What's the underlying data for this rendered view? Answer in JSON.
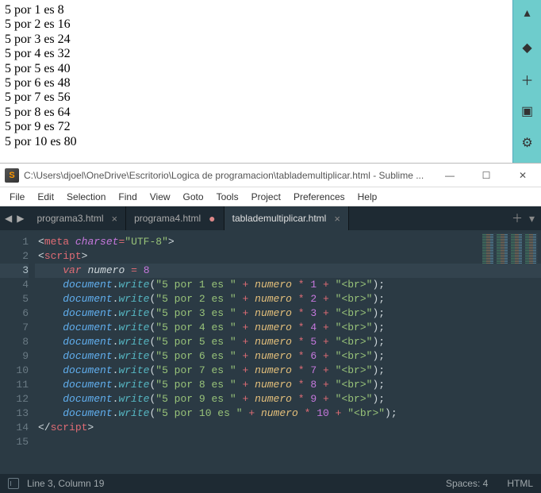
{
  "browser": {
    "lines": [
      "5 por 1 es 8",
      "5 por 2 es 16",
      "5 por 3 es 24",
      "5 por 4 es 32",
      "5 por 5 es 40",
      "5 por 6 es 48",
      "5 por 7 es 56",
      "5 por 8 es 64",
      "5 por 9 es 72",
      "5 por 10 es 80"
    ],
    "sidebar_icons": [
      "up-icon",
      "diamond-icon",
      "plus-icon",
      "window-icon",
      "gear-icon"
    ]
  },
  "editor": {
    "title": "C:\\Users\\djoel\\OneDrive\\Escritorio\\Logica de programacion\\tablademultiplicar.html - Sublime ...",
    "menus": [
      "File",
      "Edit",
      "Selection",
      "Find",
      "View",
      "Goto",
      "Tools",
      "Project",
      "Preferences",
      "Help"
    ],
    "tabs": [
      {
        "label": "programa3.html",
        "active": false,
        "dirty": false
      },
      {
        "label": "programa4.html",
        "active": false,
        "dirty": true
      },
      {
        "label": "tablademultiplicar.html",
        "active": true,
        "dirty": false
      }
    ],
    "line_numbers": [
      "1",
      "2",
      "3",
      "4",
      "5",
      "6",
      "7",
      "8",
      "9",
      "10",
      "11",
      "12",
      "13",
      "14",
      "15"
    ],
    "active_line": 3,
    "code": {
      "meta_charset": "UTF-8",
      "var_name": "numero",
      "var_value": "8",
      "writes": [
        {
          "text": "\"5 por 1 es \"",
          "mult": "1"
        },
        {
          "text": "\"5 por 2 es \"",
          "mult": "2"
        },
        {
          "text": "\"5 por 3 es \"",
          "mult": "3"
        },
        {
          "text": "\"5 por 4 es \"",
          "mult": "4"
        },
        {
          "text": "\"5 por 5 es \"",
          "mult": "5"
        },
        {
          "text": "\"5 por 6 es \"",
          "mult": "6"
        },
        {
          "text": "\"5 por 7 es \"",
          "mult": "7"
        },
        {
          "text": "\"5 por 8 es \"",
          "mult": "8"
        },
        {
          "text": "\"5 por 9 es \"",
          "mult": "9"
        },
        {
          "text": "\"5 por 10 es \"",
          "mult": "10"
        }
      ],
      "br_literal": "\"<br>\""
    },
    "status": {
      "position": "Line 3, Column 19",
      "spaces": "Spaces: 4",
      "syntax": "HTML"
    }
  }
}
